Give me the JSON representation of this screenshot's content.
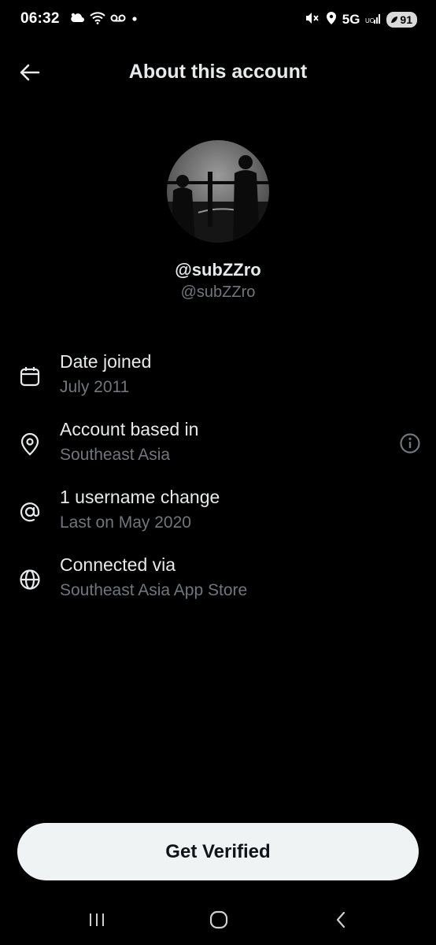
{
  "status_bar": {
    "time": "06:32",
    "network": "5G",
    "battery": "91"
  },
  "header": {
    "title": "About this account"
  },
  "profile": {
    "display_name": "@subZZro",
    "handle": "@subZZro"
  },
  "details": [
    {
      "icon": "calendar-icon",
      "label": "Date joined",
      "value": "July 2011"
    },
    {
      "icon": "location-pin-icon",
      "label": "Account based in",
      "value": "Southeast Asia"
    },
    {
      "icon": "at-sign-icon",
      "label": "1 username change",
      "value": "Last on May 2020"
    },
    {
      "icon": "globe-icon",
      "label": "Connected via",
      "value": "Southeast Asia App Store"
    }
  ],
  "cta": {
    "label": "Get Verified"
  },
  "colors": {
    "background": "#000000",
    "primary_text": "#e7e9ea",
    "secondary_text": "#71767b",
    "button_bg": "#eff3f4",
    "button_text": "#0f1419"
  }
}
